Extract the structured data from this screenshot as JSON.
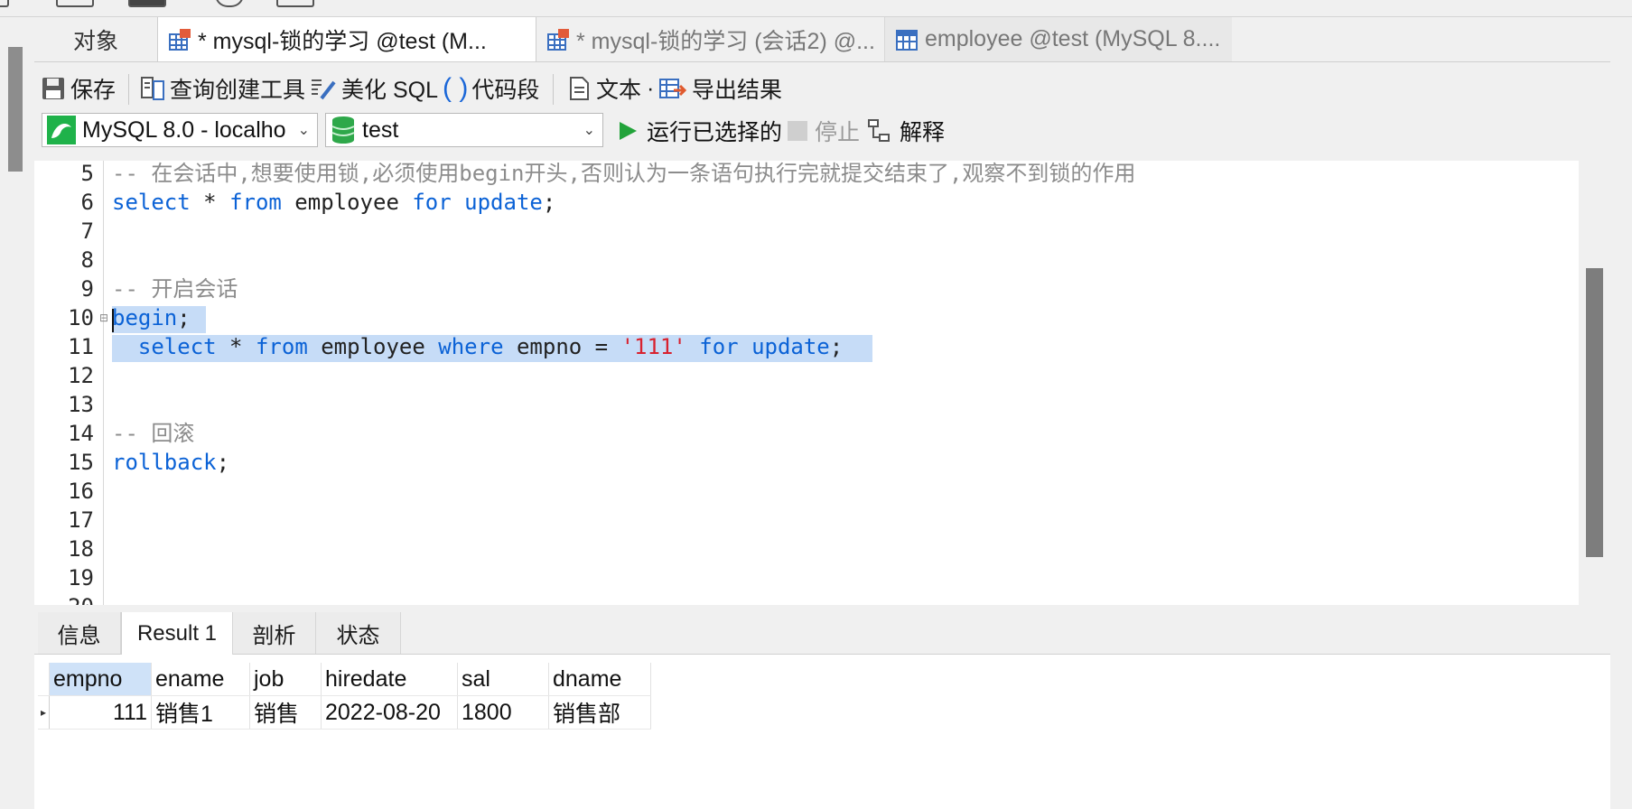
{
  "tabs": [
    {
      "label": "对象"
    },
    {
      "label": "* mysql-锁的学习 @test (M..."
    },
    {
      "label": "* mysql-锁的学习 (会话2) @..."
    },
    {
      "label": "employee @test (MySQL 8...."
    }
  ],
  "toolbar": {
    "save": "保存",
    "query_builder": "查询创建工具",
    "beautify": "美化 SQL",
    "snippet": "代码段",
    "text": "文本",
    "text_dot": "·",
    "export": "导出结果",
    "connection": "MySQL 8.0 - localho",
    "database": "test",
    "run": "运行已选择的",
    "stop": "停止",
    "explain": "解释"
  },
  "editor": {
    "lines": [
      {
        "num": "5",
        "tokens": [
          {
            "t": "cm",
            "v": "-- 在会话中,想要使用锁,必须使用begin开头,否则认为一条语句执行完就提交结束了,观察不到锁的作用"
          }
        ]
      },
      {
        "num": "6",
        "tokens": [
          {
            "t": "kw",
            "v": "select"
          },
          {
            "t": "plain",
            "v": " * "
          },
          {
            "t": "kw",
            "v": "from"
          },
          {
            "t": "plain",
            "v": " employee "
          },
          {
            "t": "kw",
            "v": "for update"
          },
          {
            "t": "plain",
            "v": ";"
          }
        ]
      },
      {
        "num": "7",
        "tokens": []
      },
      {
        "num": "8",
        "tokens": []
      },
      {
        "num": "9",
        "tokens": [
          {
            "t": "cm",
            "v": "-- 开启会话"
          }
        ]
      },
      {
        "num": "10",
        "tokens": [
          {
            "t": "kw",
            "v": "begin"
          },
          {
            "t": "plain",
            "v": ";"
          }
        ]
      },
      {
        "num": "11",
        "tokens": [
          {
            "t": "plain",
            "v": "  "
          },
          {
            "t": "kw",
            "v": "select"
          },
          {
            "t": "plain",
            "v": " * "
          },
          {
            "t": "kw",
            "v": "from"
          },
          {
            "t": "plain",
            "v": " employee "
          },
          {
            "t": "kw",
            "v": "where"
          },
          {
            "t": "plain",
            "v": " empno = "
          },
          {
            "t": "str",
            "v": "'111'"
          },
          {
            "t": "plain",
            "v": " "
          },
          {
            "t": "kw",
            "v": "for update"
          },
          {
            "t": "plain",
            "v": ";"
          }
        ]
      },
      {
        "num": "12",
        "tokens": []
      },
      {
        "num": "13",
        "tokens": []
      },
      {
        "num": "14",
        "tokens": [
          {
            "t": "cm",
            "v": "-- 回滚"
          }
        ]
      },
      {
        "num": "15",
        "tokens": [
          {
            "t": "kw",
            "v": "rollback"
          },
          {
            "t": "plain",
            "v": ";"
          }
        ]
      },
      {
        "num": "16",
        "tokens": []
      },
      {
        "num": "17",
        "tokens": []
      },
      {
        "num": "18",
        "tokens": []
      },
      {
        "num": "19",
        "tokens": []
      },
      {
        "num": "20",
        "tokens": []
      }
    ]
  },
  "result_tabs": [
    {
      "label": "信息"
    },
    {
      "label": "Result 1"
    },
    {
      "label": "剖析"
    },
    {
      "label": "状态"
    }
  ],
  "result": {
    "columns": [
      "empno",
      "ename",
      "job",
      "hiredate",
      "sal",
      "dname"
    ],
    "rows": [
      [
        "111",
        "销售1",
        "销售",
        "2022-08-20",
        "1800",
        "销售部"
      ]
    ]
  },
  "colors": {
    "keyword": "#0b62d6",
    "comment": "#8c8c8c",
    "string": "#d8222f",
    "selection": "#c6dcf7",
    "run_green": "#22a33a"
  }
}
